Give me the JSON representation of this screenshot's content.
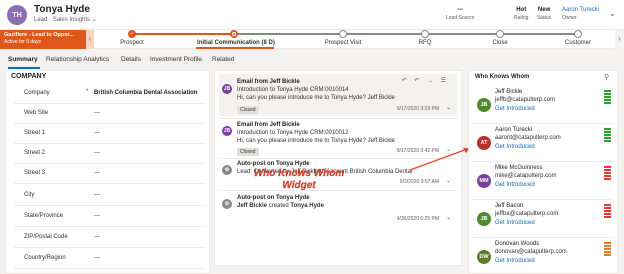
{
  "record": {
    "initials": "TH",
    "name": "Tonya Hyde",
    "entity": "Lead",
    "separator": "·",
    "form": "Sales Insights",
    "form_chevron": "chevron-down"
  },
  "header_fields": [
    {
      "value": "---",
      "label": "Lead Source"
    },
    {
      "value": "Hot",
      "label": "Rating"
    },
    {
      "value": "New",
      "label": "Status"
    },
    {
      "value": "Aaron Turecki",
      "label": "Owner"
    }
  ],
  "process": {
    "flag_title": "Gazifiere - Lead to Oppor...",
    "flag_sub": "Active for 8 days",
    "stages": [
      {
        "label": "Prospect",
        "state": "done"
      },
      {
        "label": "Initial Communication  (8 D)",
        "state": "active"
      },
      {
        "label": "Prospect Visit",
        "state": "pending"
      },
      {
        "label": "RFQ",
        "state": "pending"
      },
      {
        "label": "Close",
        "state": "pending"
      },
      {
        "label": "Customer",
        "state": "pending"
      }
    ],
    "done_glyph": "✓"
  },
  "tabs": [
    "Summary",
    "Relationship Analytics",
    "Details",
    "Investment Profile",
    "Related"
  ],
  "company": {
    "title": "COMPANY",
    "rows": [
      {
        "label": "Company",
        "value": "British Columbia Dental Association",
        "required": "*"
      },
      {
        "label": "Web Site",
        "value": "---"
      },
      {
        "label": "Street 1",
        "value": "---"
      },
      {
        "label": "Street 2",
        "value": "---"
      },
      {
        "label": "Street 3",
        "value": "---"
      },
      {
        "label": "City",
        "value": "---"
      },
      {
        "label": "State/Province",
        "value": "---"
      },
      {
        "label": "ZIP/Postal Code",
        "value": "---"
      },
      {
        "label": "Country/Region",
        "value": "---"
      }
    ]
  },
  "timeline": [
    {
      "icon": "JB",
      "title": "Email from Jeff Bickle",
      "line1": "Introduction to Tonya Hyde CRM:0010014",
      "line2": "Hi, can you please introduce me to Tonya Hyde? Jeff Bickle",
      "date": "9/17/2020 3:59 PM",
      "tag": "Closed",
      "actions": "↶ ↶ → ☰"
    },
    {
      "icon": "JB",
      "title": "Email from Jeff Bickle",
      "line1": "Introduction to Tonya Hyde CRM:0010012",
      "line2": "Hi, can you please introduce me to Tonya Hyde? Jeff Bickle",
      "date": "9/17/2020 3:42 PM",
      "tag": "Closed"
    },
    {
      "icon": "sys",
      "title": "Auto-post on Tonya Hyde",
      "line1": "Lead: Converted by Jeff Bickle to Account British Columbia Dental",
      "date": "9/2/2020 9:57 AM"
    },
    {
      "icon": "sys",
      "title": "Auto-post on Tonya Hyde",
      "line1_a": "Jeff Bickle",
      "line1_b": "created",
      "line1_c": "Tonya Hyde",
      "date": "4/30/2020 5:25 PM"
    }
  ],
  "annotation": {
    "text_line1": "Who Knows Whom",
    "text_line2": "Widget",
    "color": "#e6462d"
  },
  "wkw": {
    "title": "Who Knows Whom",
    "people": [
      {
        "initials": "JB",
        "name": "Jeff Bickle",
        "email": "jeffb@catapulterp.com",
        "link": "Get Introduced",
        "color": "#4f8a2e",
        "strength": 5,
        "bar_color": "#2ca02c"
      },
      {
        "initials": "AT",
        "name": "Aaron Turecki",
        "email": "aaront@catapulterp.com",
        "link": "Get Introduced",
        "color": "#b5322d",
        "strength": 5,
        "bar_color": "#2ca02c"
      },
      {
        "initials": "MM",
        "name": "Mike McGuinness",
        "email": "mike@catapulterp.com",
        "link": "Get Introduced",
        "color": "#7b3f9e",
        "strength": 5,
        "bar_color": "#e03c31"
      },
      {
        "initials": "JB",
        "name": "Jeff Bacon",
        "email": "jeffba@catapulterp.com",
        "link": "Get Introduced",
        "color": "#4f8a2e",
        "strength": 5,
        "bar_color": "#e03c31"
      },
      {
        "initials": "DW",
        "name": "Donovan Woods",
        "email": "donovan@catapulterp.com",
        "link": "Get Introduced",
        "color": "#607d2b",
        "strength": 5,
        "bar_color": "#e07b31"
      }
    ]
  }
}
